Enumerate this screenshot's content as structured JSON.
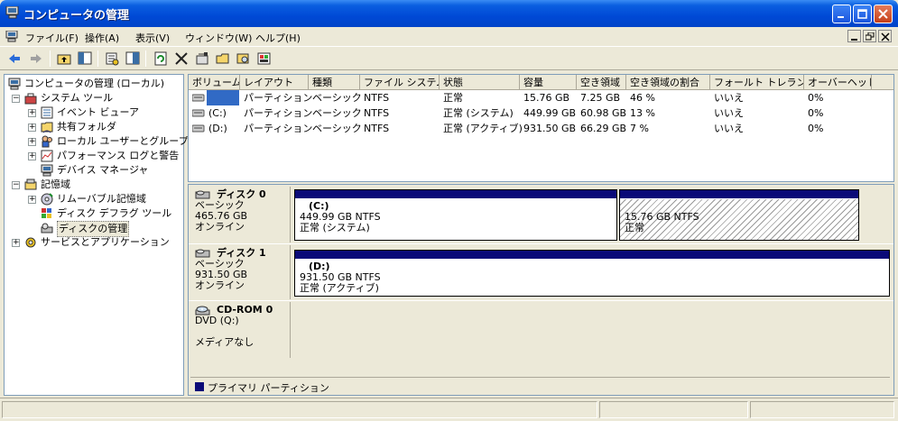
{
  "window": {
    "title": "コンピュータの管理"
  },
  "menu": {
    "file": "ファイル(F)",
    "action": "操作(A)",
    "view": "表示(V)",
    "window": "ウィンドウ(W)",
    "help": "ヘルプ(H)"
  },
  "tree": {
    "root": "コンピュータの管理 (ローカル)",
    "system_tools": "システム ツール",
    "event_viewer": "イベント ビューア",
    "shared_folders": "共有フォルダ",
    "local_users": "ローカル ユーザーとグループ",
    "perf_logs": "パフォーマンス ログと警告",
    "device_manager": "デバイス マネージャ",
    "storage": "記憶域",
    "removable": "リムーバブル記憶域",
    "defrag": "ディスク デフラグ ツール",
    "disk_mgmt": "ディスクの管理",
    "services": "サービスとアプリケーション"
  },
  "list": {
    "headers": [
      "ボリューム",
      "レイアウト",
      "種類",
      "ファイル システム",
      "状態",
      "容量",
      "空き領域",
      "空き領域の割合",
      "フォールト トレランス",
      "オーバーヘッド"
    ],
    "rows": [
      [
        "",
        "パーティション",
        "ベーシック",
        "NTFS",
        "正常",
        "15.76 GB",
        "7.25 GB",
        "46 %",
        "いいえ",
        "0%"
      ],
      [
        "(C:)",
        "パーティション",
        "ベーシック",
        "NTFS",
        "正常 (システム)",
        "449.99 GB",
        "60.98 GB",
        "13 %",
        "いいえ",
        "0%"
      ],
      [
        "(D:)",
        "パーティション",
        "ベーシック",
        "NTFS",
        "正常 (アクティブ)",
        "931.50 GB",
        "66.29 GB",
        "7 %",
        "いいえ",
        "0%"
      ]
    ]
  },
  "disks": {
    "disk0": {
      "name": "ディスク 0",
      "type": "ベーシック",
      "size": "465.76 GB",
      "status": "オンライン",
      "p1": {
        "label": "(C:)",
        "size": "449.99 GB NTFS",
        "state": "正常 (システム)"
      },
      "p2": {
        "size": "15.76 GB NTFS",
        "state": "正常"
      }
    },
    "disk1": {
      "name": "ディスク 1",
      "type": "ベーシック",
      "size": "931.50 GB",
      "status": "オンライン",
      "p1": {
        "label": "(D:)",
        "size": "931.50 GB NTFS",
        "state": "正常 (アクティブ)"
      }
    },
    "cdrom": {
      "name": "CD-ROM 0",
      "type": "DVD (Q:)",
      "status": "メディアなし"
    }
  },
  "legend": {
    "primary": "プライマリ パーティション"
  },
  "colors": {
    "partition_bar": "#0a0a78",
    "titlebar": "#0049d6"
  }
}
